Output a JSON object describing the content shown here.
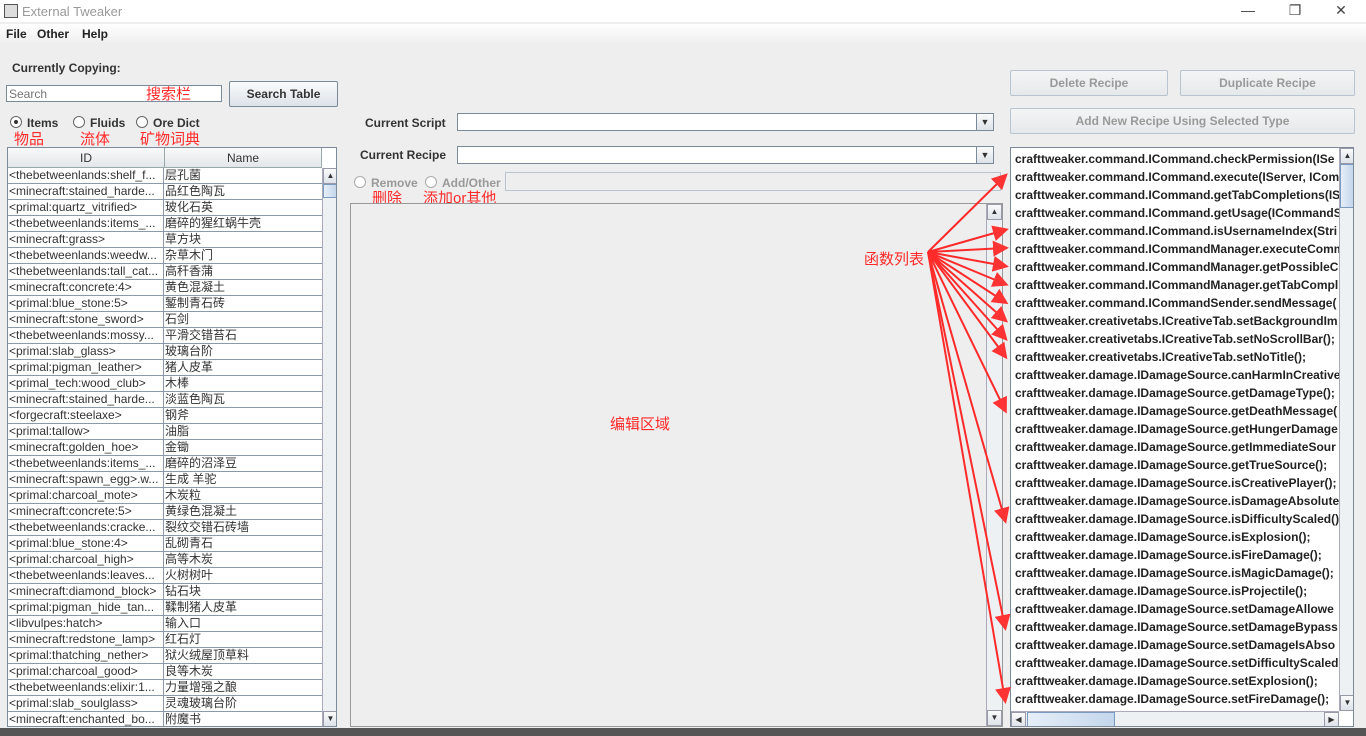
{
  "window": {
    "title": "External Tweaker",
    "minimize": "—",
    "restore": "❐",
    "close": "✕"
  },
  "menu": [
    "File",
    "Other",
    "Help"
  ],
  "copying_label": "Currently Copying:",
  "search": {
    "placeholder": "Search",
    "button": "Search Table"
  },
  "radios": {
    "items": "Items",
    "fluids": "Fluids",
    "ore_dict": "Ore Dict",
    "selected": "Items"
  },
  "table": {
    "headers": [
      "ID",
      "Name"
    ],
    "rows": [
      [
        "<thebetweenlands:shelf_f...",
        "层孔菌"
      ],
      [
        "<minecraft:stained_harde...",
        "品红色陶瓦"
      ],
      [
        "<primal:quartz_vitrified>",
        "玻化石英"
      ],
      [
        "<thebetweenlands:items_...",
        "磨碎的猩红蜗牛壳"
      ],
      [
        "<minecraft:grass>",
        "草方块"
      ],
      [
        "<thebetweenlands:weedw...",
        "杂草木门"
      ],
      [
        "<thebetweenlands:tall_cat...",
        "高秆香蒲"
      ],
      [
        "<minecraft:concrete:4>",
        "黄色混凝土"
      ],
      [
        "<primal:blue_stone:5>",
        "錾制青石砖"
      ],
      [
        "<minecraft:stone_sword>",
        "石剑"
      ],
      [
        "<thebetweenlands:mossy...",
        "平滑交错苔石"
      ],
      [
        "<primal:slab_glass>",
        "玻璃台阶"
      ],
      [
        "<primal:pigman_leather>",
        "猪人皮革"
      ],
      [
        "<primal_tech:wood_club>",
        "木棒"
      ],
      [
        "<minecraft:stained_harde...",
        "淡蓝色陶瓦"
      ],
      [
        "<forgecraft:steelaxe>",
        "钢斧"
      ],
      [
        "<primal:tallow>",
        "油脂"
      ],
      [
        "<minecraft:golden_hoe>",
        "金锄"
      ],
      [
        "<thebetweenlands:items_...",
        "磨碎的沼泽豆"
      ],
      [
        "<minecraft:spawn_egg>.w...",
        "生成 羊驼"
      ],
      [
        "<primal:charcoal_mote>",
        "木炭粒"
      ],
      [
        "<minecraft:concrete:5>",
        "黄绿色混凝土"
      ],
      [
        "<thebetweenlands:cracke...",
        "裂纹交错石砖墙"
      ],
      [
        "<primal:blue_stone:4>",
        "乱砌青石"
      ],
      [
        "<primal:charcoal_high>",
        "高等木炭"
      ],
      [
        "<thebetweenlands:leaves...",
        "火树树叶"
      ],
      [
        "<minecraft:diamond_block>",
        "钻石块"
      ],
      [
        "<primal:pigman_hide_tan...",
        "鞣制猪人皮革"
      ],
      [
        "<libvulpes:hatch>",
        "输入口"
      ],
      [
        "<minecraft:redstone_lamp>",
        "红石灯"
      ],
      [
        "<primal:thatching_nether>",
        "狱火绒屋顶草料"
      ],
      [
        "<primal:charcoal_good>",
        "良等木炭"
      ],
      [
        "<thebetweenlands:elixir:1...",
        "力量增强之酿"
      ],
      [
        "<primal:slab_soulglass>",
        "灵魂玻璃台阶"
      ],
      [
        "<minecraft:enchanted_bo...",
        "附魔书"
      ]
    ]
  },
  "script": {
    "label": "Current Script",
    "recipe_label": "Current Recipe",
    "remove": "Remove",
    "add_other": "Add/Other"
  },
  "buttons": {
    "delete": "Delete Recipe",
    "duplicate": "Duplicate Recipe",
    "add_new": "Add New Recipe Using Selected Type"
  },
  "functions": [
    "crafttweaker.command.ICommand.checkPermission(ISe",
    "crafttweaker.command.ICommand.execute(IServer, ICom",
    "crafttweaker.command.ICommand.getTabCompletions(IS",
    "crafttweaker.command.ICommand.getUsage(ICommandS",
    "crafttweaker.command.ICommand.isUsernameIndex(Stri",
    "crafttweaker.command.ICommandManager.executeComm",
    "crafttweaker.command.ICommandManager.getPossibleC",
    "crafttweaker.command.ICommandManager.getTabCompl",
    "crafttweaker.command.ICommandSender.sendMessage(",
    "crafttweaker.creativetabs.ICreativeTab.setBackgroundIm",
    "crafttweaker.creativetabs.ICreativeTab.setNoScrollBar();",
    "crafttweaker.creativetabs.ICreativeTab.setNoTitle();",
    "crafttweaker.damage.IDamageSource.canHarmInCreative",
    "crafttweaker.damage.IDamageSource.getDamageType();",
    "crafttweaker.damage.IDamageSource.getDeathMessage(",
    "crafttweaker.damage.IDamageSource.getHungerDamage",
    "crafttweaker.damage.IDamageSource.getImmediateSour",
    "crafttweaker.damage.IDamageSource.getTrueSource();",
    "crafttweaker.damage.IDamageSource.isCreativePlayer();",
    "crafttweaker.damage.IDamageSource.isDamageAbsolute",
    "crafttweaker.damage.IDamageSource.isDifficultyScaled()",
    "crafttweaker.damage.IDamageSource.isExplosion();",
    "crafttweaker.damage.IDamageSource.isFireDamage();",
    "crafttweaker.damage.IDamageSource.isMagicDamage();",
    "crafttweaker.damage.IDamageSource.isProjectile();",
    "crafttweaker.damage.IDamageSource.setDamageAllowe",
    "crafttweaker.damage.IDamageSource.setDamageBypass",
    "crafttweaker.damage.IDamageSource.setDamageIsAbso",
    "crafttweaker.damage.IDamageSource.setDifficultyScaled",
    "crafttweaker.damage.IDamageSource.setExplosion();",
    "crafttweaker.damage.IDamageSource.setFireDamage();"
  ],
  "annotations": {
    "search": "搜索栏",
    "items": "物品",
    "fluids": "流体",
    "ore_dict": "矿物词典",
    "remove": "删除",
    "add_other": "添加or其他",
    "edit_area": "编辑区域",
    "function_list": "函数列表"
  },
  "colors": {
    "annotation": "#ff2a2a"
  }
}
